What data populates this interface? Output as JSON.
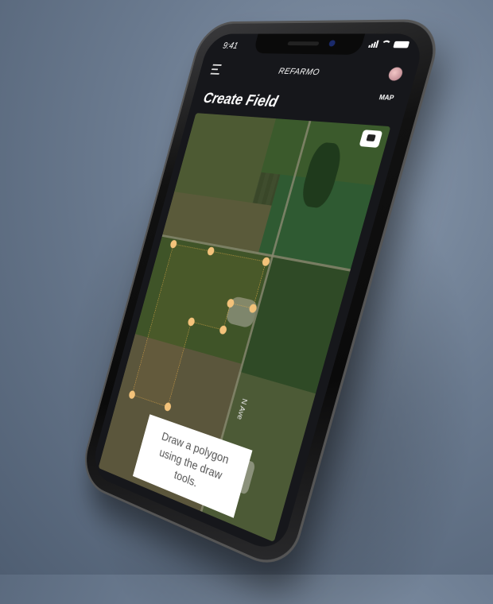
{
  "status": {
    "time": "9:41"
  },
  "header": {
    "brand": "REFARMO",
    "menu_icon": "hamburger-menu-icon",
    "avatar_icon": "user-avatar-icon"
  },
  "page": {
    "title": "Create Field",
    "map_link": "MAP"
  },
  "map": {
    "layers_icon": "layers-icon",
    "road_label": "N Ave",
    "polygon_color": "#f0b24a",
    "hint": "Draw a polygon using the draw tools."
  },
  "colors": {
    "screen_bg": "#16171b",
    "accent": "#f0b24a",
    "text": "#ffffff"
  }
}
